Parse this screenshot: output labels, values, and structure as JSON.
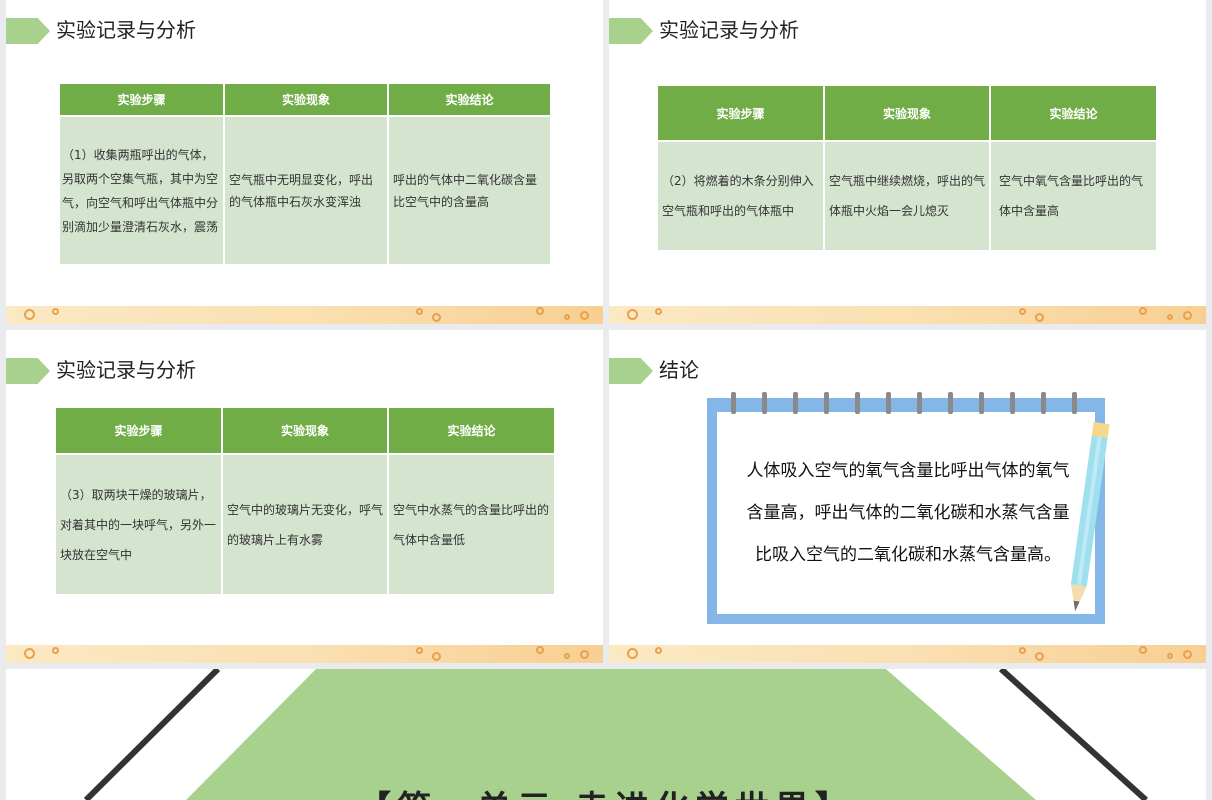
{
  "slides": [
    {
      "title": "实验记录与分析",
      "headers": [
        "实验步骤",
        "实验现象",
        "实验结论"
      ],
      "row": {
        "step": "（1）收集两瓶呼出的气体，另取两个空集气瓶，其中为空气，向空气和呼出气体瓶中分别滴加少量澄清石灰水，震荡",
        "phenomenon": "空气瓶中无明显变化，呼出的气体瓶中石灰水变浑浊",
        "conclusion": "呼出的气体中二氧化碳含量比空气中的含量高"
      }
    },
    {
      "title": "实验记录与分析",
      "headers": [
        "实验步骤",
        "实验现象",
        "实验结论"
      ],
      "row": {
        "step": "（2）将燃着的木条分别伸入空气瓶和呼出的气体瓶中",
        "phenomenon": "空气瓶中继续燃烧，呼出的气体瓶中火焰一会儿熄灭",
        "conclusion": "空气中氧气含量比呼出的气体中含量高"
      }
    },
    {
      "title": "实验记录与分析",
      "headers": [
        "实验步骤",
        "实验现象",
        "实验结论"
      ],
      "row": {
        "step": "（3）取两块干燥的玻璃片，对着其中的一块呼气，另外一块放在空气中",
        "phenomenon": "空气中的玻璃片无变化，呼气的玻璃片上有水雾",
        "conclusion": "空气中水蒸气的含量比呼出的气体中含量低"
      }
    },
    {
      "title": "结论",
      "text": "人体吸入空气的氧气含量比呼出气体的氧气含量高，呼出气体的二氧化碳和水蒸气含量比吸入空气的二氧化碳和水蒸气含量高。"
    }
  ],
  "cover": {
    "title": "【第一单元 走进化学世界】"
  },
  "colors": {
    "header_green": "#70ad47",
    "cell_green": "#d5e4ce",
    "tag_green": "#a9d18e",
    "cover_green": "#a9d18e",
    "notebook_blue": "#84b7e8"
  }
}
